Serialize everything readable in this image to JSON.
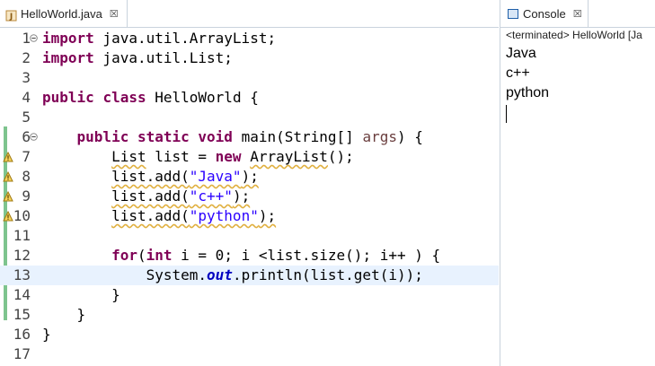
{
  "editor": {
    "tab": {
      "label": "HelloWorld.java",
      "close": "☒"
    },
    "lines": [
      {
        "n": "1",
        "segments": [
          {
            "t": "import",
            "c": "kw"
          },
          {
            "t": " java.util.ArrayList;"
          }
        ]
      },
      {
        "n": "2",
        "segments": [
          {
            "t": "import",
            "c": "kw"
          },
          {
            "t": " java.util.List;"
          }
        ]
      },
      {
        "n": "3",
        "segments": []
      },
      {
        "n": "4",
        "segments": [
          {
            "t": "public",
            "c": "kw"
          },
          {
            "t": " "
          },
          {
            "t": "class",
            "c": "kw"
          },
          {
            "t": " HelloWorld {"
          }
        ]
      },
      {
        "n": "5",
        "segments": []
      },
      {
        "n": "6",
        "segments": [
          {
            "t": "    "
          },
          {
            "t": "public",
            "c": "kw"
          },
          {
            "t": " "
          },
          {
            "t": "static",
            "c": "kw"
          },
          {
            "t": " "
          },
          {
            "t": "void",
            "c": "kw"
          },
          {
            "t": " main(String[] "
          },
          {
            "t": "args",
            "c": "arg"
          },
          {
            "t": ") {"
          }
        ]
      },
      {
        "n": "7",
        "segments": [
          {
            "t": "        "
          },
          {
            "t": "List",
            "c": "warn"
          },
          {
            "t": " list = "
          },
          {
            "t": "new",
            "c": "kw"
          },
          {
            "t": " "
          },
          {
            "t": "ArrayList",
            "c": "warn"
          },
          {
            "t": "();"
          }
        ]
      },
      {
        "n": "8",
        "segments": [
          {
            "t": "        "
          },
          {
            "t": "list.add(",
            "c": "warn"
          },
          {
            "t": "\"Java\"",
            "c": "str warn"
          },
          {
            "t": ");",
            "c": "warn"
          }
        ]
      },
      {
        "n": "9",
        "segments": [
          {
            "t": "        "
          },
          {
            "t": "list.add(",
            "c": "warn"
          },
          {
            "t": "\"c++\"",
            "c": "str warn"
          },
          {
            "t": ");",
            "c": "warn"
          }
        ]
      },
      {
        "n": "10",
        "segments": [
          {
            "t": "        "
          },
          {
            "t": "list.add(",
            "c": "warn"
          },
          {
            "t": "\"python\"",
            "c": "str warn"
          },
          {
            "t": ");",
            "c": "warn"
          }
        ]
      },
      {
        "n": "11",
        "segments": []
      },
      {
        "n": "12",
        "segments": [
          {
            "t": "        "
          },
          {
            "t": "for",
            "c": "kw"
          },
          {
            "t": "("
          },
          {
            "t": "int",
            "c": "kw"
          },
          {
            "t": " i = 0; i <list.size(); i++ ) {"
          }
        ]
      },
      {
        "n": "13",
        "segments": [
          {
            "t": "            System."
          },
          {
            "t": "out",
            "c": "fld"
          },
          {
            "t": ".println(list.get(i));"
          }
        ]
      },
      {
        "n": "14",
        "segments": [
          {
            "t": "        }"
          }
        ]
      },
      {
        "n": "15",
        "segments": [
          {
            "t": "    }"
          }
        ]
      },
      {
        "n": "16",
        "segments": [
          {
            "t": "}"
          }
        ]
      },
      {
        "n": "17",
        "segments": []
      }
    ],
    "fold_lines": [
      "1",
      "6"
    ],
    "warning_lines": [
      "7",
      "8",
      "9",
      "10"
    ],
    "current_line": "13"
  },
  "console": {
    "tab": {
      "label": "Console",
      "close": "☒"
    },
    "status": "<terminated> HelloWorld [Ja",
    "output": [
      "Java",
      "c++",
      "python"
    ]
  },
  "colors": {
    "keyword": "#7f0055",
    "string": "#2a00ff",
    "field": "#0000c0",
    "current_line_bg": "#e8f2fe",
    "change_bar": "#7ec48e"
  },
  "icons": {
    "editor_tab": "java-file-icon",
    "console_tab": "console-icon",
    "fold": "fold-minus-icon",
    "warning": "warning-icon"
  }
}
